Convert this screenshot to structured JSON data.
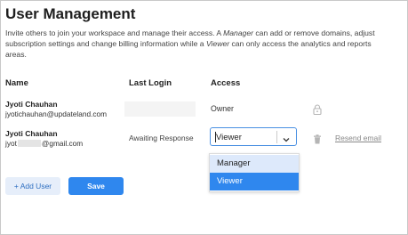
{
  "page": {
    "title": "User Management",
    "intro_1": "Invite others to join your workspace and manage their access. A ",
    "intro_manager": "Manager",
    "intro_2": " can add or remove domains, adjust subscription settings and change billing information while a ",
    "intro_viewer": "Viewer",
    "intro_3": " can only access the analytics and reports areas."
  },
  "table": {
    "headers": {
      "name": "Name",
      "last_login": "Last Login",
      "access": "Access"
    },
    "rows": [
      {
        "name": "Jyoti Chauhan",
        "email": "jyotichauhan@updateland.com",
        "last_login": "",
        "access": "Owner",
        "icon": "lock-icon"
      },
      {
        "name": "Jyoti Chauhan",
        "email_prefix": "jyot",
        "email_suffix": "@gmail.com",
        "last_login": "Awaiting Response",
        "access": "Viewer",
        "icon": "trash-icon",
        "action": "Resend email"
      }
    ]
  },
  "dropdown": {
    "options": [
      "Manager",
      "Viewer"
    ],
    "selected": "Viewer"
  },
  "buttons": {
    "add_user": "+ Add User",
    "save": "Save"
  },
  "colors": {
    "accent": "#2f87ee",
    "option_hover": "#dde9fb",
    "add_user_bg": "#e6eefa"
  }
}
